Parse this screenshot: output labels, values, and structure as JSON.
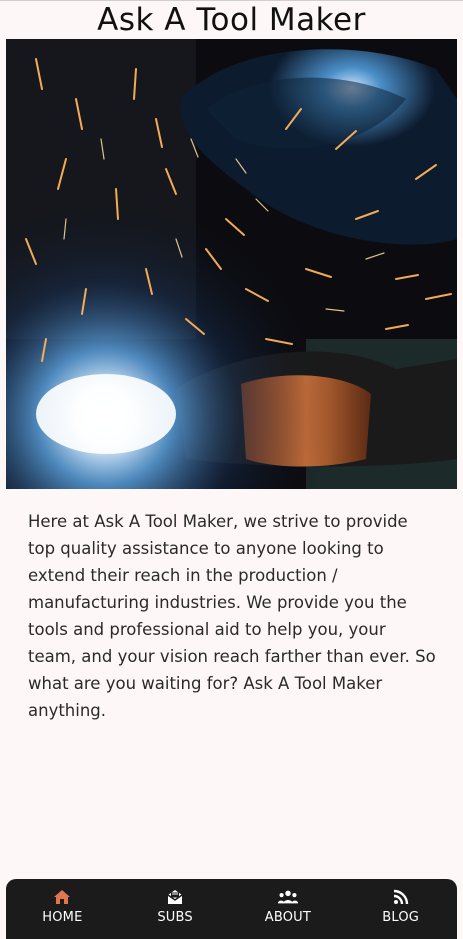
{
  "header": {
    "title": "Ask A Tool Maker"
  },
  "hero": {
    "image": "welder-sparks-photo"
  },
  "intro": {
    "text": "Here at Ask A Tool Maker, we strive to provide top quality assistance to anyone looking to extend their reach in the production / manufacturing industries. We provide you the tools and professional aid to help you, your team, and your vision reach farther than ever. So what are you waiting for? Ask A Tool Maker anything."
  },
  "nav": {
    "items": [
      {
        "label": "HOME",
        "icon": "home-icon",
        "active": true
      },
      {
        "label": "SUBS",
        "icon": "envelope-icon",
        "active": false
      },
      {
        "label": "ABOUT",
        "icon": "users-icon",
        "active": false
      },
      {
        "label": "BLOG",
        "icon": "rss-icon",
        "active": false
      }
    ]
  },
  "colors": {
    "background": "#fdf8f7",
    "nav_background": "#1b1b1b",
    "nav_active_icon": "#e0764f",
    "nav_icon": "#ffffff"
  }
}
